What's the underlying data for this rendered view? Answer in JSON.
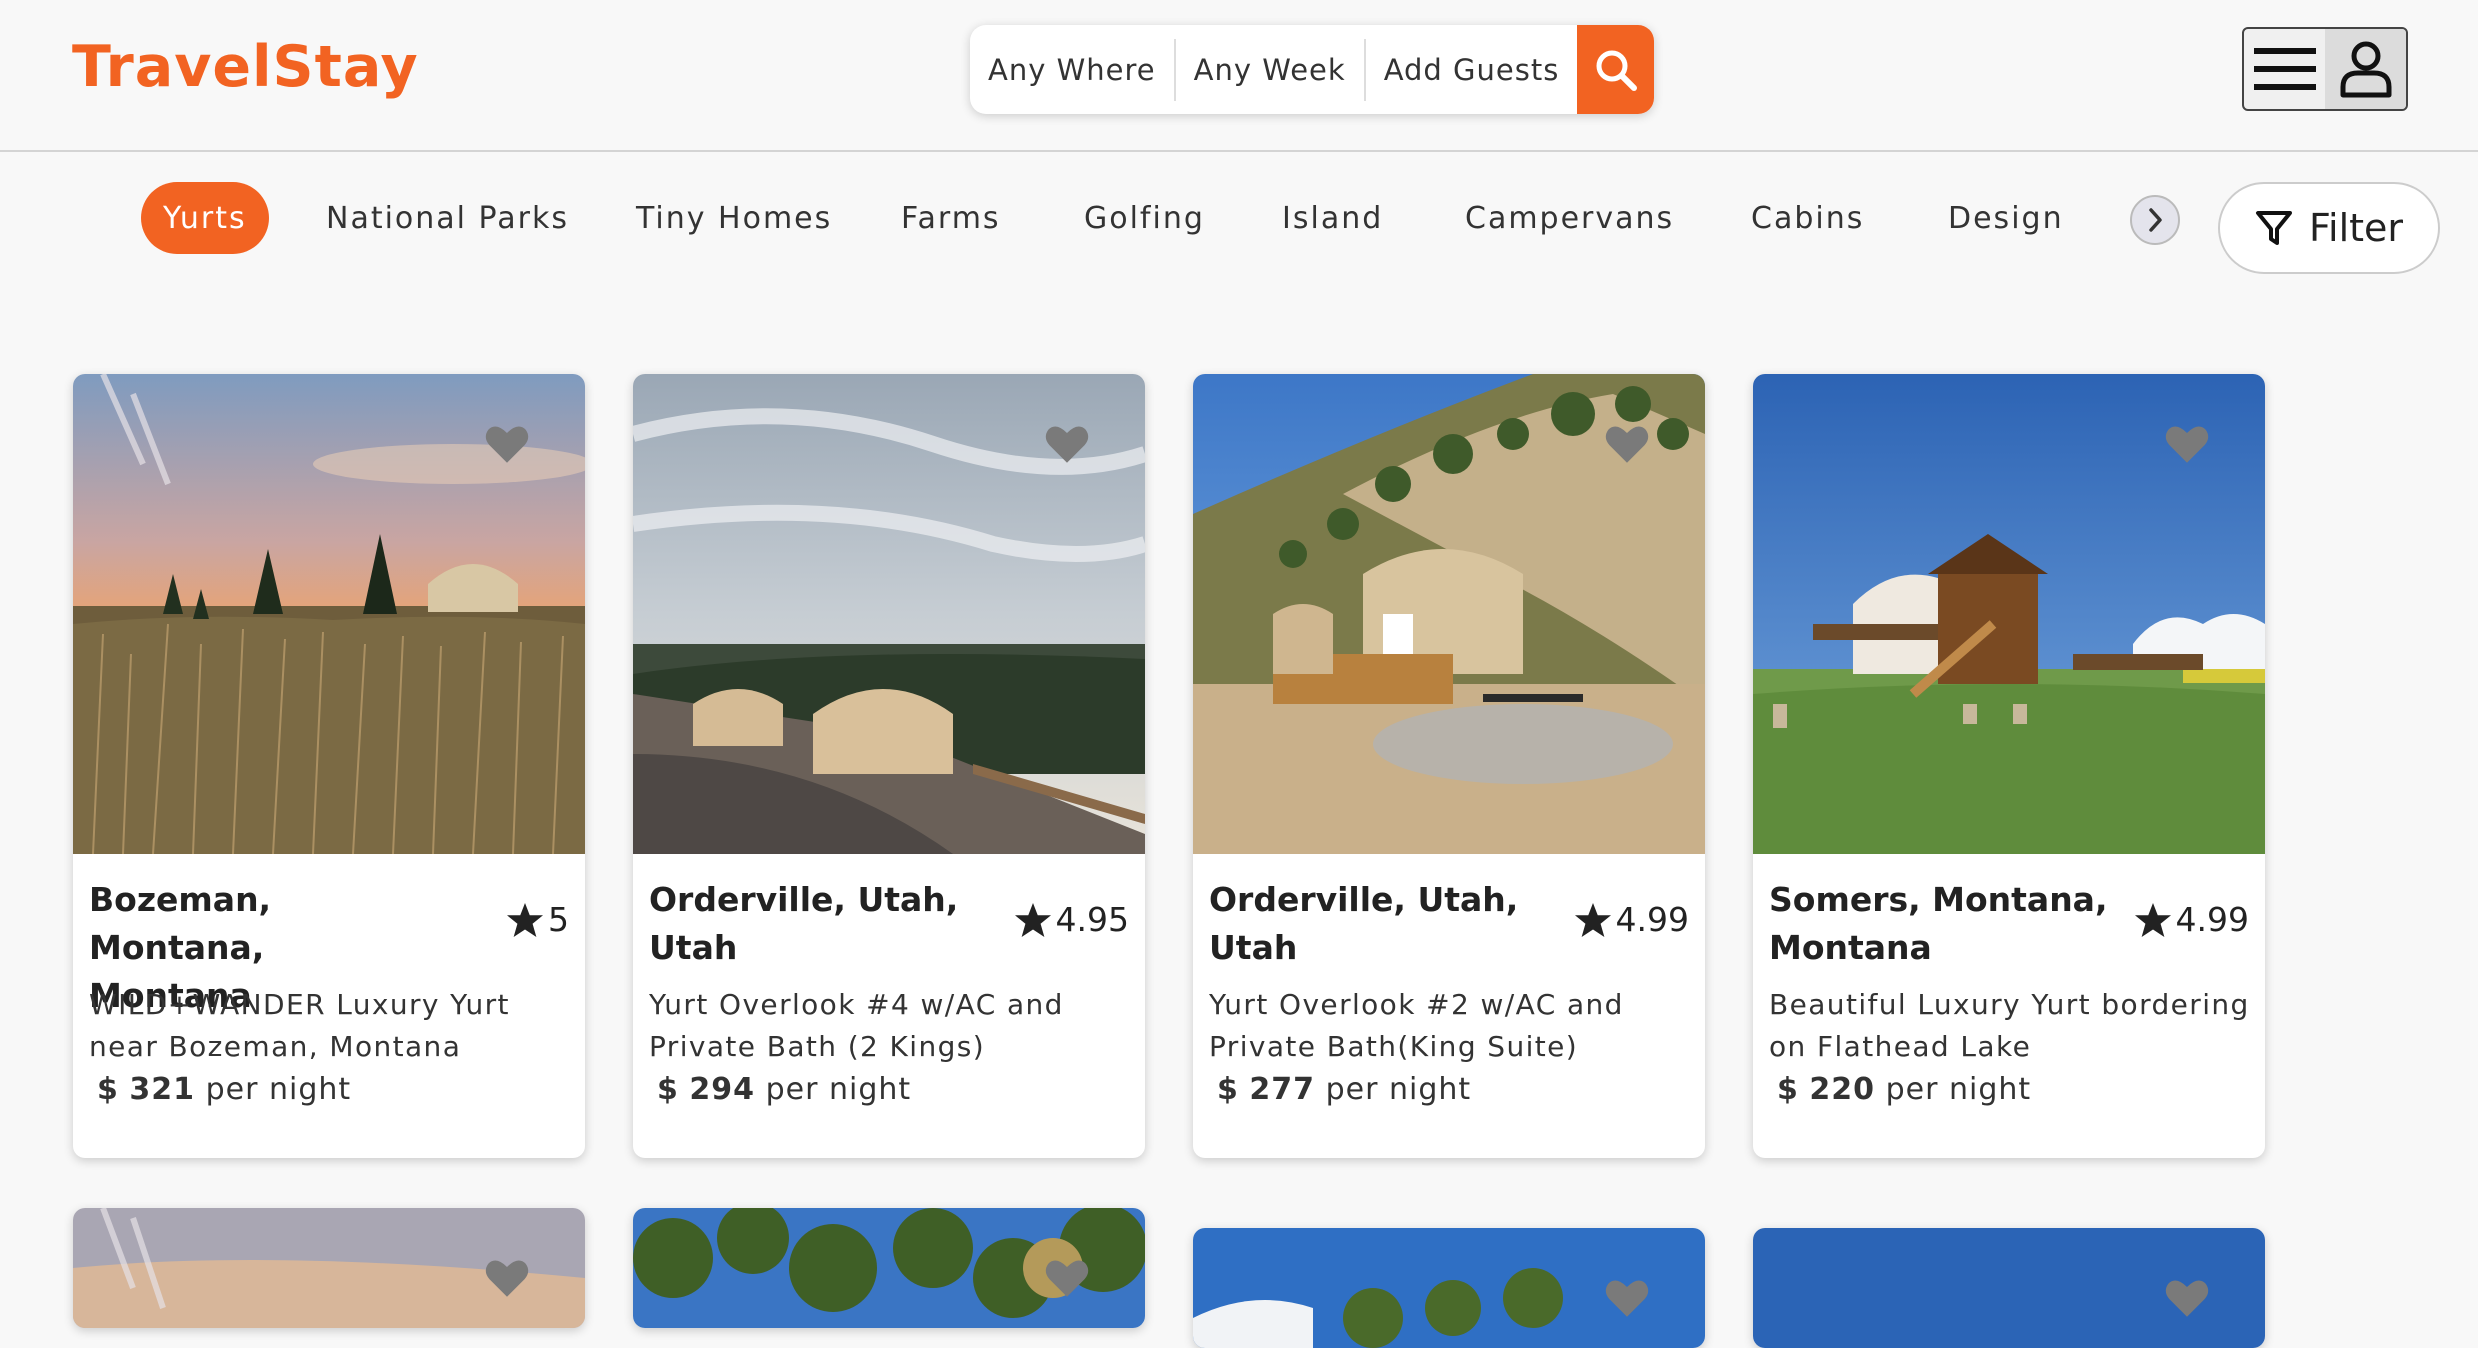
{
  "header": {
    "logo": "TravelStay",
    "search": {
      "where": "Any Where",
      "week": "Any Week",
      "guests": "Add Guests"
    }
  },
  "categories": [
    {
      "label": "Yurts",
      "active": true
    },
    {
      "label": "National Parks"
    },
    {
      "label": "Tiny Homes"
    },
    {
      "label": "Farms"
    },
    {
      "label": "Golfing"
    },
    {
      "label": "Island"
    },
    {
      "label": "Campervans"
    },
    {
      "label": "Cabins"
    },
    {
      "label": "Design"
    }
  ],
  "filter_label": "Filter",
  "listings": [
    {
      "location": "Bozeman, Montana, Montana",
      "rating": "5",
      "title": "WILD+WANDER Luxury Yurt near Bozeman, Montana",
      "currency": "$",
      "price": "321",
      "unit": "per night"
    },
    {
      "location": "Orderville, Utah, Utah",
      "rating": "4.95",
      "title": "Yurt Overlook #4 w/AC and Private Bath (2 Kings)",
      "currency": "$",
      "price": "294",
      "unit": "per night"
    },
    {
      "location": "Orderville, Utah, Utah",
      "rating": "4.99",
      "title": "Yurt Overlook #2 w/AC and Private Bath(King Suite)",
      "currency": "$",
      "price": "277",
      "unit": "per night"
    },
    {
      "location": "Somers, Montana, Montana",
      "rating": "4.99",
      "title": "Beautiful Luxury Yurt bordering on Flathead Lake",
      "currency": "$",
      "price": "220",
      "unit": "per night"
    }
  ],
  "colors": {
    "accent": "#f26322",
    "heart": "#7a7a7a"
  }
}
